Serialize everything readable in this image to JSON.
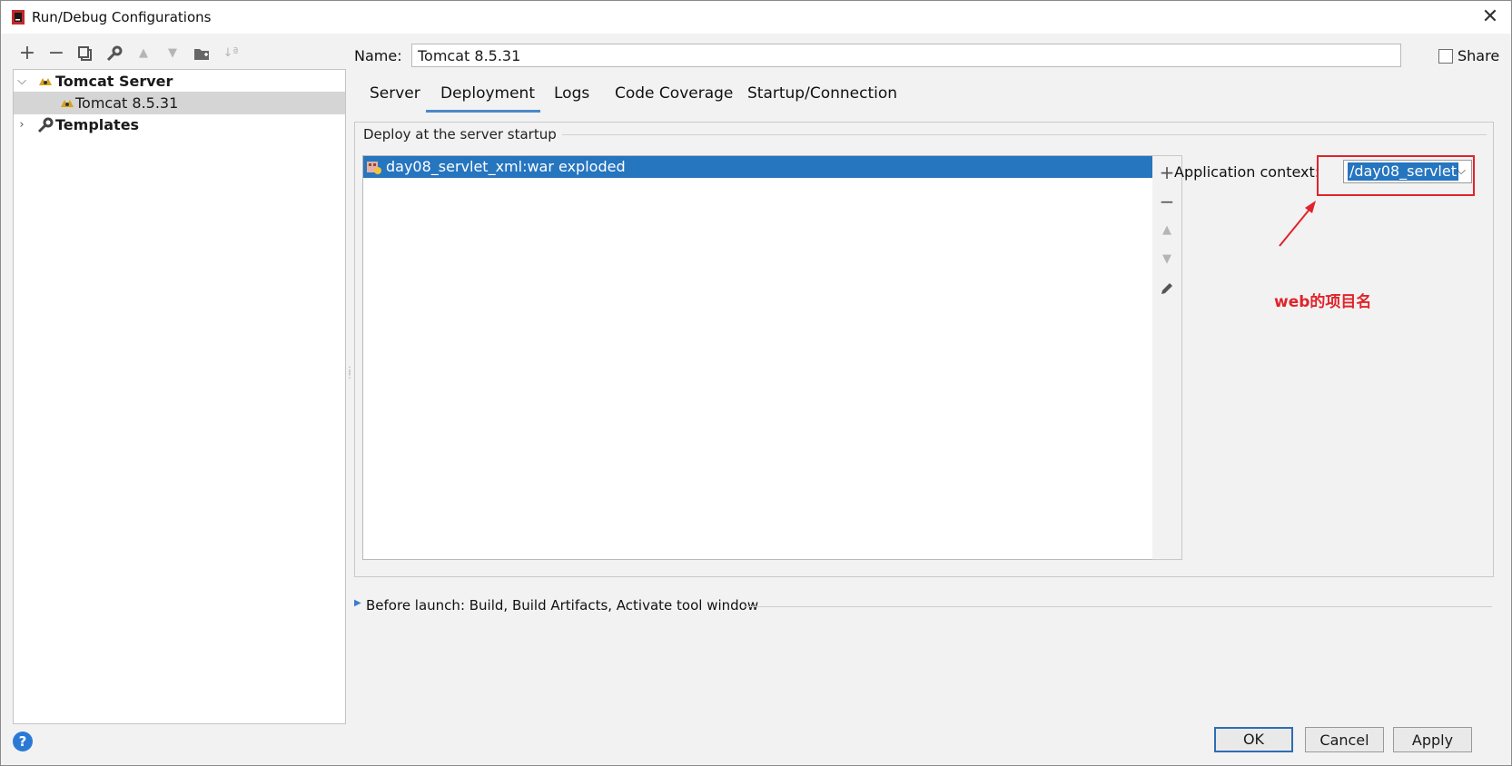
{
  "window": {
    "title": "Run/Debug Configurations"
  },
  "toolbar": {
    "add": "+",
    "remove": "−",
    "copy": "⧉",
    "edit": "🔧",
    "up": "▲",
    "down": "▼",
    "folder": "📁",
    "sort": "↓ª"
  },
  "tree": {
    "group_label": "Tomcat Server",
    "item_label": "Tomcat 8.5.31",
    "templates_label": "Templates"
  },
  "form": {
    "name_label": "Name:",
    "name_value": "Tomcat 8.5.31",
    "share_label": "Share",
    "share_checked": false
  },
  "tabs": [
    {
      "label": "Server"
    },
    {
      "label": "Deployment",
      "active": true
    },
    {
      "label": "Logs"
    },
    {
      "label": "Code Coverage"
    },
    {
      "label": "Startup/Connection"
    }
  ],
  "deploy": {
    "group_title": "Deploy at the server startup",
    "items": [
      "day08_servlet_xml:war exploded"
    ],
    "app_context_label": "Application context:",
    "app_context_value": "/day08_servlet"
  },
  "annotation": {
    "text": "web的项目名",
    "color": "#e0242a"
  },
  "before_launch": {
    "label": "Before launch: Build, Build Artifacts, Activate tool window"
  },
  "buttons": {
    "ok": "OK",
    "cancel": "Cancel",
    "apply": "Apply",
    "help": "?"
  },
  "colors": {
    "selection": "#2675bf",
    "accent": "#4a88c7",
    "annotation": "#e0242a"
  }
}
